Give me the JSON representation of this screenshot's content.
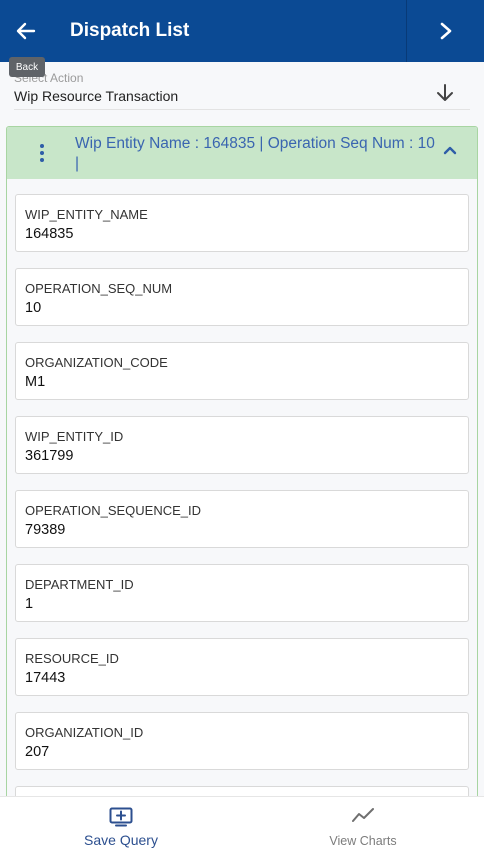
{
  "header": {
    "title": "Dispatch List",
    "back_tooltip": "Back",
    "accent": "#0b4a94"
  },
  "select_action": {
    "label": "Select Action",
    "value": "Wip Resource Transaction"
  },
  "panel": {
    "title": "Wip Entity Name : 164835 | Operation Seq Num : 10 |",
    "header_color": "#c8e6c9",
    "fields": [
      {
        "name": "WIP_ENTITY_NAME",
        "value": "164835"
      },
      {
        "name": "OPERATION_SEQ_NUM",
        "value": "10"
      },
      {
        "name": "ORGANIZATION_CODE",
        "value": "M1"
      },
      {
        "name": "WIP_ENTITY_ID",
        "value": "361799"
      },
      {
        "name": "OPERATION_SEQUENCE_ID",
        "value": "79389"
      },
      {
        "name": "DEPARTMENT_ID",
        "value": "1"
      },
      {
        "name": "RESOURCE_ID",
        "value": "17443"
      },
      {
        "name": "ORGANIZATION_ID",
        "value": "207"
      }
    ]
  },
  "bottom_bar": {
    "save_label": "Save Query",
    "save_icon": "add-to-screen-icon",
    "charts_label": "View Charts",
    "charts_icon": "trend-line-icon"
  }
}
